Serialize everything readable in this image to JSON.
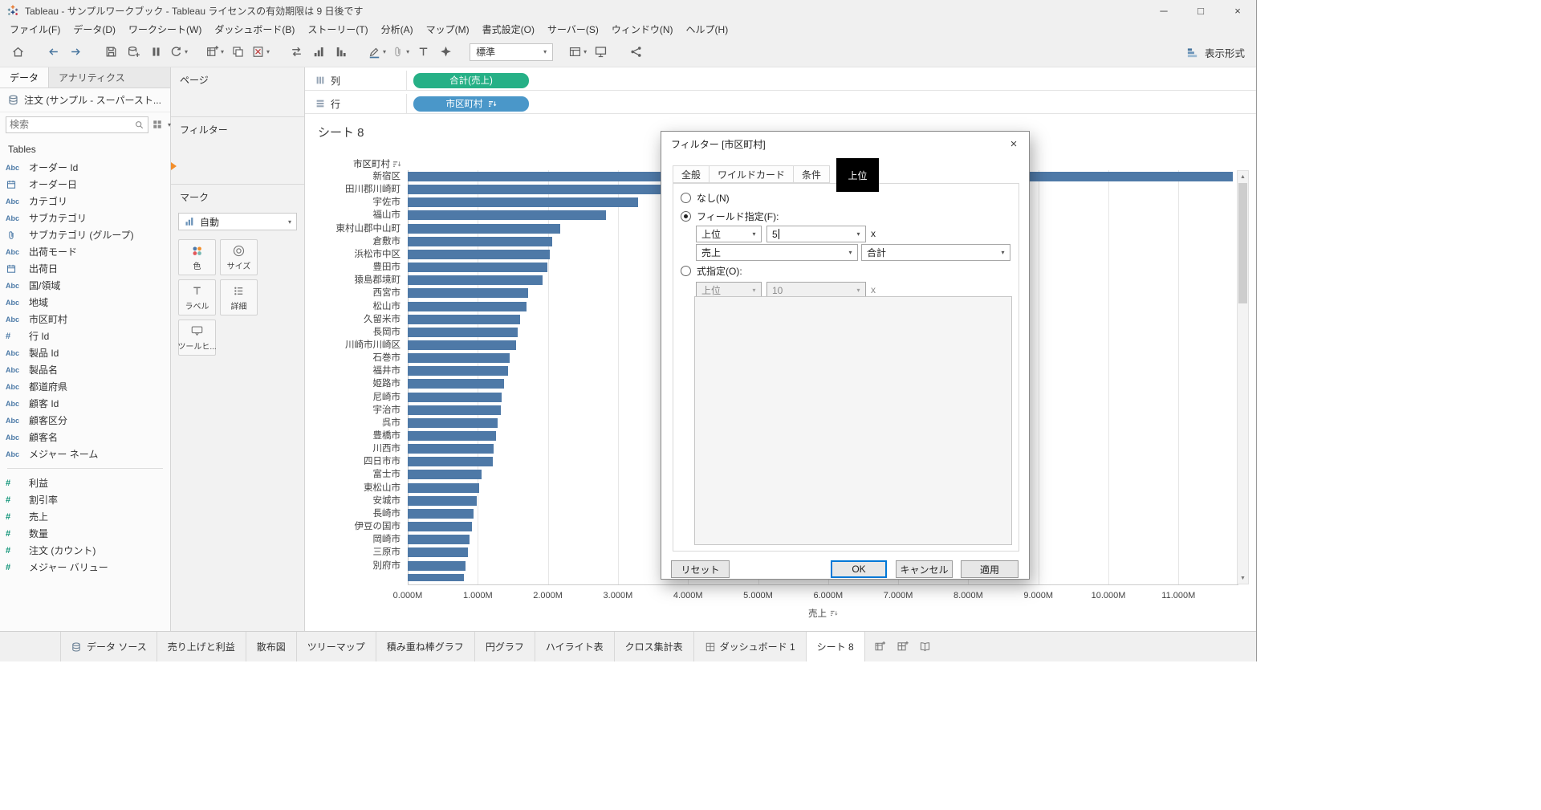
{
  "colors": {
    "bar_blue": "#4e79a7",
    "pill_green": "#26b086",
    "pill_blue": "#4a97c9",
    "dimension_blue": "#4c7aa7",
    "measure_green": "#0c9276",
    "focus_blue": "#0078d7",
    "annotation_black": "#000000",
    "indicator_orange": "#f28e2b"
  },
  "titlebar": {
    "title": "Tableau - サンプルワークブック - Tableau ライセンスの有効期限は 9 日後です"
  },
  "menubar": {
    "items": [
      "ファイル(F)",
      "データ(D)",
      "ワークシート(W)",
      "ダッシュボード(B)",
      "ストーリー(T)",
      "分析(A)",
      "マップ(M)",
      "書式設定(O)",
      "サーバー(S)",
      "ウィンドウ(N)",
      "ヘルプ(H)"
    ]
  },
  "toolbar": {
    "fit_value": "標準",
    "show_me": "表示形式",
    "items": [
      {
        "icon": "home"
      },
      {
        "icon": "undo",
        "gap": true
      },
      {
        "icon": "redo"
      },
      {
        "icon": "save",
        "gap": true
      },
      {
        "icon": "new-data-source"
      },
      {
        "icon": "pause-updates"
      },
      {
        "icon": "auto-updates",
        "dropdown": true
      },
      {
        "icon": "new-worksheet",
        "dropdown": true,
        "gap": true
      },
      {
        "icon": "duplicate"
      },
      {
        "icon": "clear-sheet",
        "dropdown": true
      },
      {
        "icon": "swap-axes",
        "gap": true
      },
      {
        "icon": "sort-ascending"
      },
      {
        "icon": "sort-descending"
      },
      {
        "icon": "highlight",
        "dropdown": true,
        "gap": true
      },
      {
        "icon": "group",
        "dropdown": true,
        "disabled": true
      },
      {
        "icon": "show-mark-labels"
      },
      {
        "icon": "explain-data"
      },
      {
        "fit": true,
        "gap": true
      },
      {
        "icon": "show-hide-cards",
        "dropdown": true,
        "gap": true
      },
      {
        "icon": "presentation-mode"
      },
      {
        "icon": "share",
        "gap": true
      }
    ]
  },
  "sidebar": {
    "tabs": [
      {
        "label": "データ",
        "active": true
      },
      {
        "label": "アナリティクス",
        "active": false
      }
    ],
    "data_source": "注文 (サンプル - スーパースト...",
    "search_placeholder": "検索",
    "tables_label": "Tables",
    "fields": [
      {
        "icon": "Abc",
        "type": "dimension",
        "label": "オーダー Id"
      },
      {
        "icon": "calendar",
        "type": "dimension",
        "label": "オーダー日"
      },
      {
        "icon": "Abc",
        "type": "dimension",
        "label": "カテゴリ"
      },
      {
        "icon": "Abc",
        "type": "dimension",
        "label": "サブカテゴリ"
      },
      {
        "icon": "paperclip",
        "type": "dimension",
        "label": "サブカテゴリ (グループ)"
      },
      {
        "icon": "Abc",
        "type": "dimension",
        "label": "出荷モード"
      },
      {
        "icon": "calendar",
        "type": "dimension",
        "label": "出荷日"
      },
      {
        "icon": "Abc",
        "type": "dimension",
        "label": "国/領域"
      },
      {
        "icon": "Abc",
        "type": "dimension",
        "label": "地域"
      },
      {
        "icon": "Abc",
        "type": "dimension",
        "label": "市区町村"
      },
      {
        "icon": "#",
        "type": "dimension",
        "label": "行 Id"
      },
      {
        "icon": "Abc",
        "type": "dimension",
        "label": "製品 Id"
      },
      {
        "icon": "Abc",
        "type": "dimension",
        "label": "製品名"
      },
      {
        "icon": "Abc",
        "type": "dimension",
        "label": "都道府県"
      },
      {
        "icon": "Abc",
        "type": "dimension",
        "label": "顧客 Id"
      },
      {
        "icon": "Abc",
        "type": "dimension",
        "label": "顧客区分"
      },
      {
        "icon": "Abc",
        "type": "dimension",
        "label": "顧客名"
      },
      {
        "icon": "Abc",
        "type": "dimension",
        "label": "メジャー ネーム"
      },
      {
        "icon": "#",
        "type": "measure",
        "label": "利益",
        "separator_before": true
      },
      {
        "icon": "#",
        "type": "measure",
        "label": "割引率"
      },
      {
        "icon": "#",
        "type": "measure",
        "label": "売上"
      },
      {
        "icon": "#",
        "type": "measure",
        "label": "数量"
      },
      {
        "icon": "#",
        "type": "measure",
        "label": "注文 (カウント)"
      },
      {
        "icon": "#",
        "type": "measure",
        "label": "メジャー バリュー"
      }
    ]
  },
  "cards": {
    "pages": "ページ",
    "filters": "フィルター",
    "marks": {
      "title": "マーク",
      "type_selector": "自動",
      "buttons": [
        {
          "icon": "color",
          "label": "色"
        },
        {
          "icon": "size",
          "label": "サイズ"
        },
        {
          "icon": "label",
          "label": "ラベル"
        },
        {
          "icon": "detail",
          "label": "詳細"
        },
        {
          "icon": "tooltip",
          "label": "ツールヒ..."
        }
      ]
    }
  },
  "shelves": {
    "columns": {
      "label": "列",
      "pill": {
        "text": "合計(売上)",
        "color": "#26b086"
      }
    },
    "rows": {
      "label": "行",
      "pill": {
        "text": "市区町村",
        "color": "#4a97c9",
        "sorted": true
      }
    }
  },
  "sheet": {
    "title": "シート 8"
  },
  "chart_data": {
    "type": "bar",
    "orientation": "horizontal",
    "title": "シート 8",
    "row_field": "市区町村",
    "xlabel": "売上",
    "unit": "M",
    "sort": "descending by 売上",
    "grid": "vertical",
    "legend": "none",
    "xlim_m": [
      0,
      11.85
    ],
    "x_ticks": [
      "0.000M",
      "1.000M",
      "2.000M",
      "3.000M",
      "4.000M",
      "5.000M",
      "6.000M",
      "7.000M",
      "8.000M",
      "9.000M",
      "10.000M",
      "11.000M"
    ],
    "bar_color": "#4e79a7",
    "categories": [
      "新宿区",
      "田川郡川崎町",
      "宇佐市",
      "福山市",
      "東村山郡中山町",
      "倉敷市",
      "浜松市中区",
      "豊田市",
      "猿島郡境町",
      "西宮市",
      "松山市",
      "久留米市",
      "長岡市",
      "川崎市川崎区",
      "石巻市",
      "福井市",
      "姫路市",
      "尼崎市",
      "宇治市",
      "呉市",
      "豊橋市",
      "川西市",
      "四日市市",
      "富士市",
      "東松山市",
      "安城市",
      "長崎市",
      "伊豆の国市",
      "岡崎市",
      "三原市",
      "別府市",
      ""
    ],
    "values_m": [
      11.78,
      3.65,
      3.29,
      2.83,
      2.18,
      2.06,
      2.03,
      1.99,
      1.92,
      1.72,
      1.7,
      1.6,
      1.57,
      1.55,
      1.45,
      1.43,
      1.37,
      1.34,
      1.33,
      1.28,
      1.26,
      1.23,
      1.21,
      1.05,
      1.02,
      0.99,
      0.94,
      0.92,
      0.88,
      0.86,
      0.82,
      0.8
    ]
  },
  "dialog": {
    "title": "フィルター [市区町村]",
    "tabs": [
      {
        "name": "general",
        "label": "全般"
      },
      {
        "name": "wildcard",
        "label": "ワイルドカード"
      },
      {
        "name": "condition",
        "label": "条件"
      },
      {
        "name": "top",
        "label": "上位",
        "active": true,
        "annotated": true
      }
    ],
    "options": {
      "none": "なし(N)",
      "by_field": "フィールド指定(F):",
      "by_formula": "式指定(O):"
    },
    "selected_option": "by_field",
    "by_field": {
      "direction": "上位",
      "count": "5",
      "times": "x",
      "field": "売上",
      "aggregation": "合計"
    },
    "by_formula": {
      "direction": "上位",
      "count": "10",
      "times": "x",
      "disabled": true
    },
    "buttons": {
      "reset": "リセット",
      "ok": "OK",
      "cancel": "キャンセル",
      "apply": "適用"
    }
  },
  "tabbar": {
    "data_source_tab": {
      "icon": "database",
      "label": "データ ソース"
    },
    "sheet_tabs": [
      {
        "label": "売り上げと利益"
      },
      {
        "label": "散布図"
      },
      {
        "label": "ツリーマップ"
      },
      {
        "label": "積み重ね棒グラフ"
      },
      {
        "label": "円グラフ"
      },
      {
        "label": "ハイライト表"
      },
      {
        "label": "クロス集計表"
      },
      {
        "icon": "dashboard",
        "label": "ダッシュボード 1"
      },
      {
        "label": "シート 8",
        "active": true
      }
    ],
    "new_buttons": [
      {
        "icon": "new-worksheet-tab"
      },
      {
        "icon": "new-dashboard-tab"
      },
      {
        "icon": "new-story-tab"
      }
    ]
  }
}
